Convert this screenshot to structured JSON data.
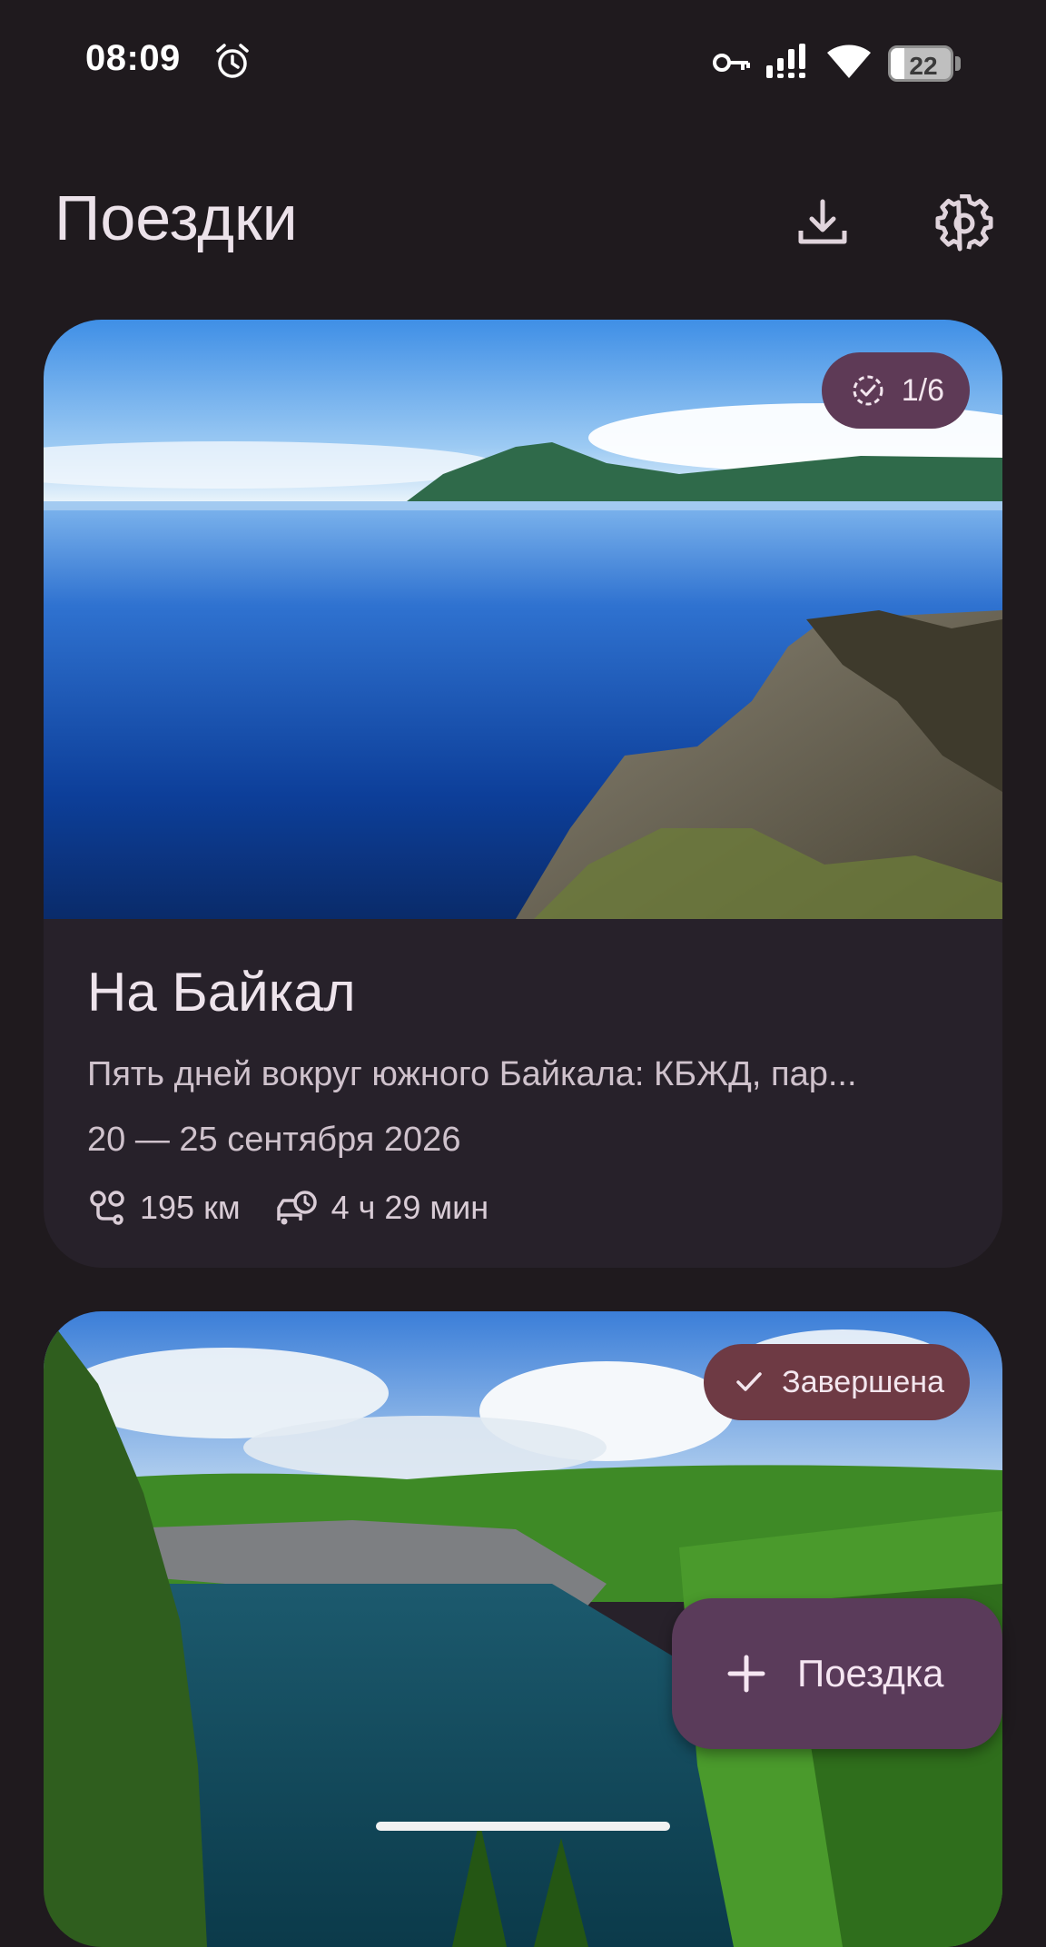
{
  "status_bar": {
    "time": "08:09",
    "battery_level": "22",
    "battery_fraction": 0.22,
    "icons": [
      "alarm-icon",
      "vpn-key-icon",
      "signal-icon",
      "wifi-icon",
      "battery-icon"
    ]
  },
  "header": {
    "title": "Поездки",
    "icons": [
      "download-icon",
      "settings-gear-icon"
    ]
  },
  "trips": [
    {
      "badge": "1/6",
      "badge_icon": "progress-check-icon",
      "title": "На Байкал",
      "description": "Пять дней вокруг южного Байкала: КБЖД, пар...",
      "dates": "20 — 25 сентября 2026",
      "distance": "195 км",
      "duration": "4 ч 29 мин"
    },
    {
      "badge": "Завершена",
      "badge_icon": "check-icon"
    }
  ],
  "fab": {
    "label": "Поездка",
    "icon": "plus-icon"
  },
  "colors": {
    "background": "#1f1a1e",
    "card": "#27212a",
    "badge_progress": "#5e3a56",
    "badge_done": "#6e3a44",
    "fab": "#5a3b5a"
  }
}
